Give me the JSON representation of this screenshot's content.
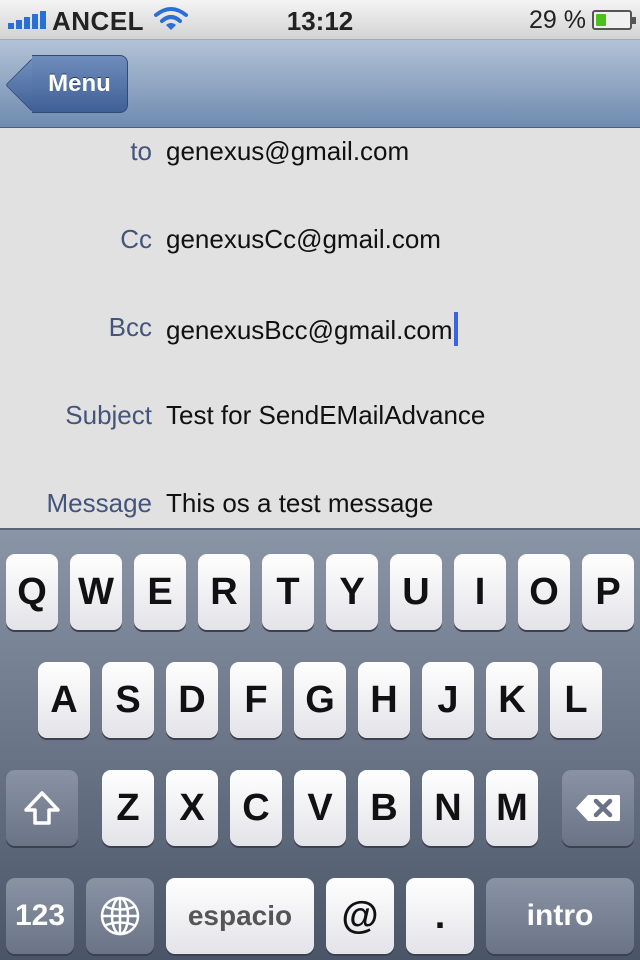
{
  "status_bar": {
    "carrier": "ANCEL",
    "time": "13:12",
    "battery_text": "29 %",
    "battery_level": 0.29,
    "icons": [
      "signal-bars-icon",
      "wifi-icon",
      "battery-icon"
    ]
  },
  "nav": {
    "back_label": "Menu"
  },
  "form": {
    "to_label": "to",
    "to_value": "genexus@gmail.com",
    "cc_label": "Cc",
    "cc_value": "genexusCc@gmail.com",
    "bcc_label": "Bcc",
    "bcc_value": "genexusBcc@gmail.com",
    "subject_label": "Subject",
    "subject_value": "Test for SendEMailAdvance",
    "message_label": "Message",
    "message_value": "This os a test message"
  },
  "keyboard": {
    "row1": [
      "Q",
      "W",
      "E",
      "R",
      "T",
      "Y",
      "U",
      "I",
      "O",
      "P"
    ],
    "row2": [
      "A",
      "S",
      "D",
      "F",
      "G",
      "H",
      "J",
      "K",
      "L"
    ],
    "row3": [
      "Z",
      "X",
      "C",
      "V",
      "B",
      "N",
      "M"
    ],
    "numbers_label": "123",
    "space_label": "espacio",
    "at_label": "@",
    "dot_label": ".",
    "return_label": "intro",
    "icons": [
      "shift-icon",
      "backspace-icon",
      "globe-icon"
    ]
  }
}
